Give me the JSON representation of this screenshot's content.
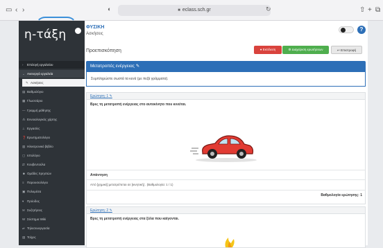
{
  "browser": {
    "url": "eclass.sch.gr",
    "lock_icon": "lock-icon"
  },
  "sidebar": {
    "logo_text": "η-τάξη",
    "items": [
      {
        "label": "Επιλογή εργαλείου",
        "icon": "chevron-right-icon",
        "style": "header"
      },
      {
        "label": "Ανενεργά εργαλεία",
        "icon": "chevron-down-icon",
        "style": "header2"
      },
      {
        "label": "Ασκήσεις",
        "icon": "edit-icon",
        "style": "active"
      },
      {
        "label": "Βαθμολόγιο",
        "icon": "gradebook-icon",
        "style": "normal"
      },
      {
        "label": "Γλωσσάριο",
        "icon": "glossary-icon",
        "style": "normal"
      },
      {
        "label": "Γραμμή μάθησης",
        "icon": "path-icon",
        "style": "normal"
      },
      {
        "label": "Εννοιολογικός χάρτης",
        "icon": "map-icon",
        "style": "normal"
      },
      {
        "label": "Εργασίες",
        "icon": "assignment-icon",
        "style": "normal"
      },
      {
        "label": "Ερωτηματολόγιο",
        "icon": "questionnaire-icon",
        "style": "normal"
      },
      {
        "label": "Ηλεκτρονικό βιβλίο",
        "icon": "book-icon",
        "style": "normal"
      },
      {
        "label": "Ιστολόγιο",
        "icon": "blog-icon",
        "style": "normal"
      },
      {
        "label": "Κουβεντούλα",
        "icon": "chat-icon",
        "style": "normal"
      },
      {
        "label": "Ομάδες Χρηστών",
        "icon": "users-icon",
        "style": "normal"
      },
      {
        "label": "Παρουσιολόγιο",
        "icon": "attendance-icon",
        "style": "normal"
      },
      {
        "label": "Πολυμέσα",
        "icon": "media-icon",
        "style": "normal"
      },
      {
        "label": "Πρόοδος",
        "icon": "progress-icon",
        "style": "normal"
      },
      {
        "label": "Συζητήσεις",
        "icon": "forum-icon",
        "style": "normal"
      },
      {
        "label": "Σύστημα Wiki",
        "icon": "wiki-icon",
        "style": "normal"
      },
      {
        "label": "Τηλεσυνεργασία",
        "icon": "teleconf-icon",
        "style": "normal"
      },
      {
        "label": "Τοίχος",
        "icon": "wall-icon",
        "style": "normal"
      }
    ]
  },
  "header": {
    "course_title": "ΦΥΣΙΚΗ",
    "course_subtitle": "Ασκήσεις",
    "preview_label": "Προεπισκόπηση",
    "buttons": {
      "execute": "Εκτέλεση",
      "manage": "Διαχείριση ερωτήσεων",
      "back": "Επιστροφή"
    }
  },
  "exercise": {
    "title": "Μετατροπές ενέργειας",
    "instructions": "Συμπληρώστε σωστά τα κενά (με πεζά γράμματα)."
  },
  "questions": [
    {
      "label": "Ερώτηση: 1",
      "text": "Βρες τη μετατροπή ενέργειας στο αυτοκίνητο που κινείται.",
      "answer_heading": "Απάντηση",
      "answer_text": "Από [χημική] μετατρέπεται σε [κινητική] . (Βαθμολογία: 1 / 1)",
      "score": "Βαθμολογία ερώτησης: 1"
    },
    {
      "label": "Ερώτηση: 2",
      "text": "Βρες τη μετατροπή ενέργειας στα ξύλα που καίγονται."
    }
  ],
  "colors": {
    "accent": "#2d6fb7",
    "danger": "#d9433d",
    "success": "#4fae4e",
    "sidebar": "#2e3338"
  }
}
